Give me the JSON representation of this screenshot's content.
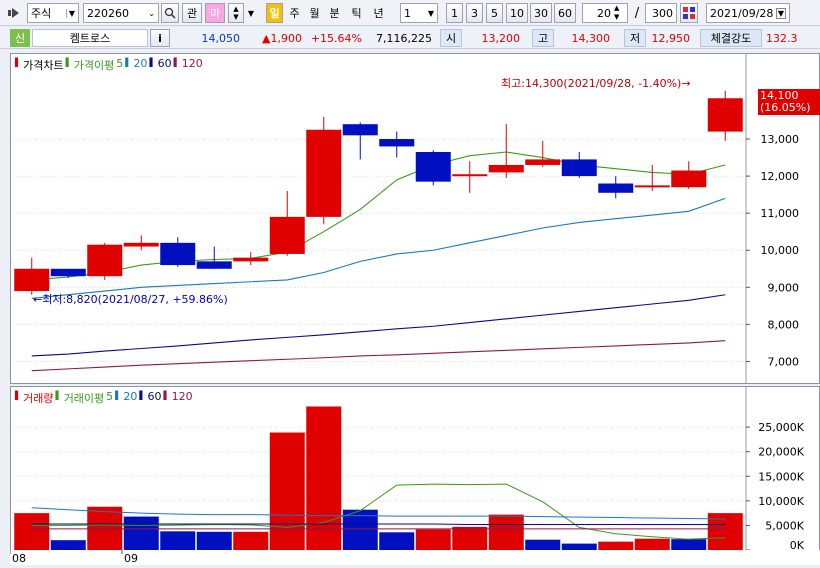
{
  "toolbar": {
    "market_type": "주식",
    "code": "220260",
    "btn_gwan": "관",
    "btn_ma": "마",
    "periods": [
      "일",
      "주",
      "월",
      "분",
      "틱",
      "년"
    ],
    "active_period": "일",
    "interval_value": "1",
    "ranges": [
      "1",
      "3",
      "5",
      "10",
      "30",
      "60"
    ],
    "count_value": "20",
    "slash": "/",
    "total_value": "300",
    "date_value": "2021/09/28"
  },
  "info": {
    "badge": "신",
    "name": "켐트로스",
    "info_btn": "i",
    "price": "14,050",
    "change": "▲1,900",
    "change_pct": "+15.64%",
    "volume": "7,116,225",
    "open_label": "시",
    "open_value": "13,200",
    "high_label": "고",
    "high_value": "14,300",
    "low_label": "저",
    "low_value": "12,950",
    "strength_label": "체결강도",
    "strength_value": "132.3"
  },
  "price_legend": {
    "title": "가격차트",
    "ma_label": "가격이평",
    "ma_periods": [
      "5",
      "20",
      "60",
      "120"
    ]
  },
  "volume_legend": {
    "title": "거래량",
    "ma_label": "거래이평",
    "ma_periods": [
      "5",
      "20",
      "60",
      "120"
    ]
  },
  "price_annotations": {
    "high": "최고:14,300(2021/09/28, -1.40%)→",
    "low": "←최저:8,820(2021/08/27, +59.86%)",
    "last_price": "14,100",
    "last_pct": "(16.05%)"
  },
  "colors": {
    "up": "#e00000",
    "down": "#0010c0",
    "ma5": "#3a9a1a",
    "ma20": "#1a78c2",
    "ma60": "#0a0a8a",
    "ma120": "#8a1a4a"
  },
  "chart_data": [
    {
      "type": "candlestick",
      "title": "가격차트",
      "ylim": [
        6500,
        14700
      ],
      "y_ticks": [
        7000,
        8000,
        9000,
        10000,
        11000,
        12000,
        13000
      ],
      "y_tick_labels": [
        "7,000",
        "8,000",
        "9,000",
        "10,000",
        "11,000",
        "12,000",
        "13,000"
      ],
      "candles": [
        {
          "o": 8900,
          "h": 9800,
          "l": 8800,
          "c": 9500
        },
        {
          "o": 9500,
          "h": 9500,
          "l": 9250,
          "c": 9300
        },
        {
          "o": 9300,
          "h": 10200,
          "l": 9200,
          "c": 10150
        },
        {
          "o": 10100,
          "h": 10400,
          "l": 10000,
          "c": 10200
        },
        {
          "o": 10200,
          "h": 10350,
          "l": 9550,
          "c": 9600
        },
        {
          "o": 9700,
          "h": 10100,
          "l": 9500,
          "c": 9500
        },
        {
          "o": 9700,
          "h": 9950,
          "l": 9600,
          "c": 9800
        },
        {
          "o": 9900,
          "h": 11600,
          "l": 9850,
          "c": 10900
        },
        {
          "o": 10900,
          "h": 13600,
          "l": 10700,
          "c": 13250
        },
        {
          "o": 13400,
          "h": 13450,
          "l": 12450,
          "c": 13100
        },
        {
          "o": 13000,
          "h": 13200,
          "l": 12500,
          "c": 12800
        },
        {
          "o": 12650,
          "h": 12700,
          "l": 11750,
          "c": 11850
        },
        {
          "o": 12000,
          "h": 12400,
          "l": 11550,
          "c": 12050
        },
        {
          "o": 12100,
          "h": 13400,
          "l": 11950,
          "c": 12300
        },
        {
          "o": 12300,
          "h": 12950,
          "l": 12250,
          "c": 12450
        },
        {
          "o": 12450,
          "h": 12650,
          "l": 11950,
          "c": 12000
        },
        {
          "o": 11800,
          "h": 12000,
          "l": 11400,
          "c": 11550
        },
        {
          "o": 11700,
          "h": 12300,
          "l": 11600,
          "c": 11750
        },
        {
          "o": 11700,
          "h": 12400,
          "l": 11650,
          "c": 12150
        },
        {
          "o": 13200,
          "h": 14300,
          "l": 12950,
          "c": 14100
        }
      ],
      "ma": {
        "ma5": [
          9200,
          9280,
          9400,
          9600,
          9700,
          9750,
          9780,
          9950,
          10500,
          11100,
          11900,
          12300,
          12550,
          12650,
          12500,
          12300,
          12200,
          12100,
          12050,
          12300
        ],
        "ma20": [
          8700,
          8800,
          8900,
          9000,
          9050,
          9100,
          9150,
          9200,
          9400,
          9700,
          9900,
          10000,
          10200,
          10400,
          10600,
          10750,
          10850,
          10950,
          11050,
          11400
        ],
        "ma60": [
          7150,
          7200,
          7280,
          7350,
          7420,
          7500,
          7580,
          7650,
          7720,
          7800,
          7880,
          7950,
          8050,
          8150,
          8250,
          8350,
          8450,
          8550,
          8650,
          8800
        ],
        "ma120": [
          6750,
          6800,
          6850,
          6900,
          6940,
          6980,
          7020,
          7060,
          7100,
          7150,
          7180,
          7220,
          7260,
          7300,
          7340,
          7380,
          7420,
          7460,
          7500,
          7560
        ]
      }
    },
    {
      "type": "bar",
      "title": "거래량",
      "ylim": [
        0,
        29500
      ],
      "y_ticks": [
        0,
        5000,
        10000,
        15000,
        20000,
        25000
      ],
      "y_tick_labels": [
        "0K",
        "5,000K",
        "10,000K",
        "15,000K",
        "20,000K",
        "25,000K"
      ],
      "values": [
        7500,
        2000,
        8800,
        6800,
        3800,
        3700,
        3700,
        23900,
        29200,
        8200,
        3600,
        4200,
        4700,
        7200,
        2100,
        1300,
        1700,
        2300,
        2200,
        7500
      ],
      "up": [
        true,
        false,
        true,
        false,
        false,
        false,
        true,
        true,
        true,
        false,
        false,
        true,
        true,
        true,
        false,
        false,
        true,
        true,
        false,
        true
      ],
      "ma": {
        "ma5": [
          5000,
          5000,
          5100,
          5000,
          5050,
          5200,
          5100,
          4600,
          5600,
          8000,
          13200,
          13400,
          13300,
          13400,
          9800,
          4600,
          3300,
          2700,
          2200,
          2500
        ],
        "ma20": [
          8600,
          8200,
          7800,
          7500,
          7300,
          7200,
          7200,
          7100,
          7000,
          7000,
          6900,
          6900,
          6900,
          6900,
          6800,
          6700,
          6600,
          6500,
          6400,
          6300
        ],
        "ma60": [
          5300,
          5300,
          5300,
          5300,
          5300,
          5300,
          5300,
          5300,
          5300,
          5300,
          5300,
          5300,
          5200,
          5200,
          5200,
          5200,
          5200,
          5200,
          5200,
          5200
        ],
        "ma120": [
          4300,
          4300,
          4300,
          4300,
          4300,
          4300,
          4300,
          4300,
          4300,
          4300,
          4300,
          4300,
          4300,
          4300,
          4300,
          4300,
          4300,
          4300,
          4300,
          4300
        ]
      }
    }
  ],
  "date_axis": [
    {
      "label": "08",
      "index": 0
    },
    {
      "label": "09",
      "index": 3
    }
  ]
}
